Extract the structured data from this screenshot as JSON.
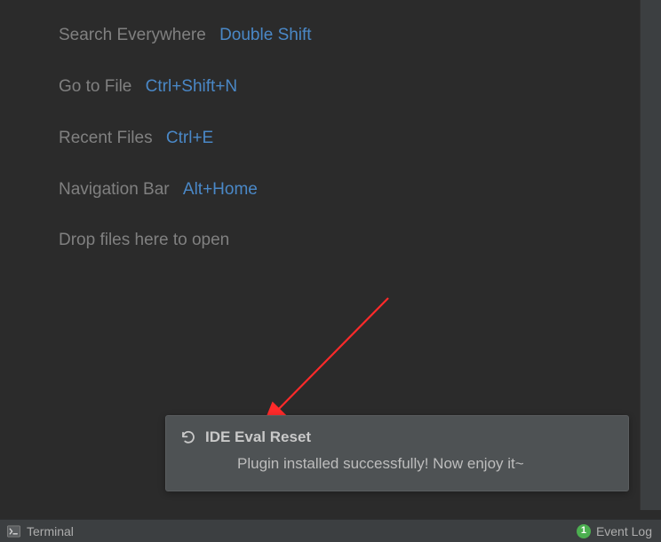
{
  "hints": {
    "search_everywhere": {
      "label": "Search Everywhere",
      "shortcut": "Double Shift"
    },
    "go_to_file": {
      "label": "Go to File",
      "shortcut": "Ctrl+Shift+N"
    },
    "recent_files": {
      "label": "Recent Files",
      "shortcut": "Ctrl+E"
    },
    "navigation_bar": {
      "label": "Navigation Bar",
      "shortcut": "Alt+Home"
    },
    "drop_hint": "Drop files here to open"
  },
  "notification": {
    "title": "IDE Eval Reset",
    "body": "Plugin installed successfully! Now enjoy it~"
  },
  "status_bar": {
    "terminal_label": "Terminal",
    "event_log_label": "Event Log",
    "event_count": "1"
  }
}
